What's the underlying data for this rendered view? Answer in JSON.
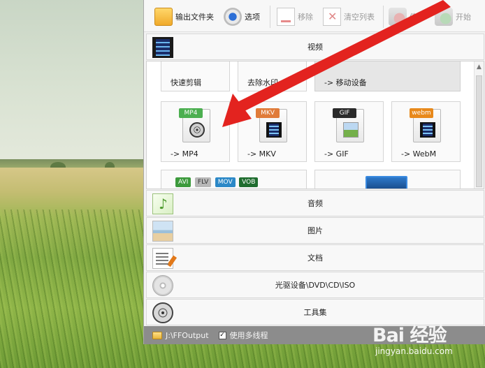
{
  "toolbar": {
    "output_folder": "输出文件夹",
    "options": "选项",
    "remove": "移除",
    "clear_list": "清空列表",
    "stop": "停止",
    "start": "开始"
  },
  "categories": {
    "video": "视频",
    "audio": "音频",
    "image": "图片",
    "document": "文档",
    "disc": "光驱设备\\DVD\\CD\\ISO",
    "tools": "工具集"
  },
  "video_tiles": {
    "quick_clip": "快速剪辑",
    "remove_watermark": "去除水印",
    "mobile_device": "-> 移动设备",
    "mp4": "-> MP4",
    "mkv": "-> MKV",
    "gif": "-> GIF",
    "webm": "-> WebM"
  },
  "format_badges": {
    "mp4": "MP4",
    "mkv": "MKV",
    "gif": "GIF",
    "webm": "webm",
    "avi": "AVI",
    "flv": "FLV",
    "mov": "MOV",
    "vob": "VOB"
  },
  "colors": {
    "mp4_badge": "#4caf50",
    "mkv_badge": "#e07b39",
    "gif_badge": "#2a2a2a",
    "webm_badge": "#e8891b",
    "arrow": "#e3231f",
    "statusbar": "#8c8c8c"
  },
  "statusbar": {
    "output_path": "J:\\FFOutput",
    "multithread_checked": "✓",
    "multithread_label": "使用多线程"
  },
  "watermark": {
    "logo": "Bai 经验",
    "url": "jingyan.baidu.com"
  }
}
